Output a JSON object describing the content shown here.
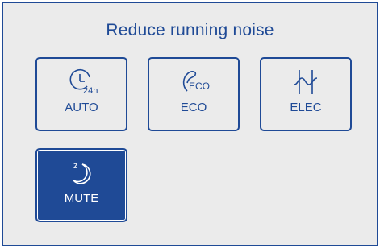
{
  "screen": {
    "title": "Reduce running noise"
  },
  "modes": [
    {
      "key": "auto",
      "label": "AUTO",
      "icon": "clock-24h-icon",
      "icon_text": "24h",
      "selected": false
    },
    {
      "key": "eco",
      "label": "ECO",
      "icon": "eco-leaf-icon",
      "icon_text": "ECO",
      "selected": false
    },
    {
      "key": "elec",
      "label": "ELEC",
      "icon": "electric-coil-icon",
      "selected": false
    },
    {
      "key": "mute",
      "label": "MUTE",
      "icon": "moon-sleep-icon",
      "icon_text": "z",
      "selected": true
    }
  ],
  "colors": {
    "accent": "#1f4a96",
    "background": "#ebebeb",
    "active_text": "#ffffff"
  }
}
